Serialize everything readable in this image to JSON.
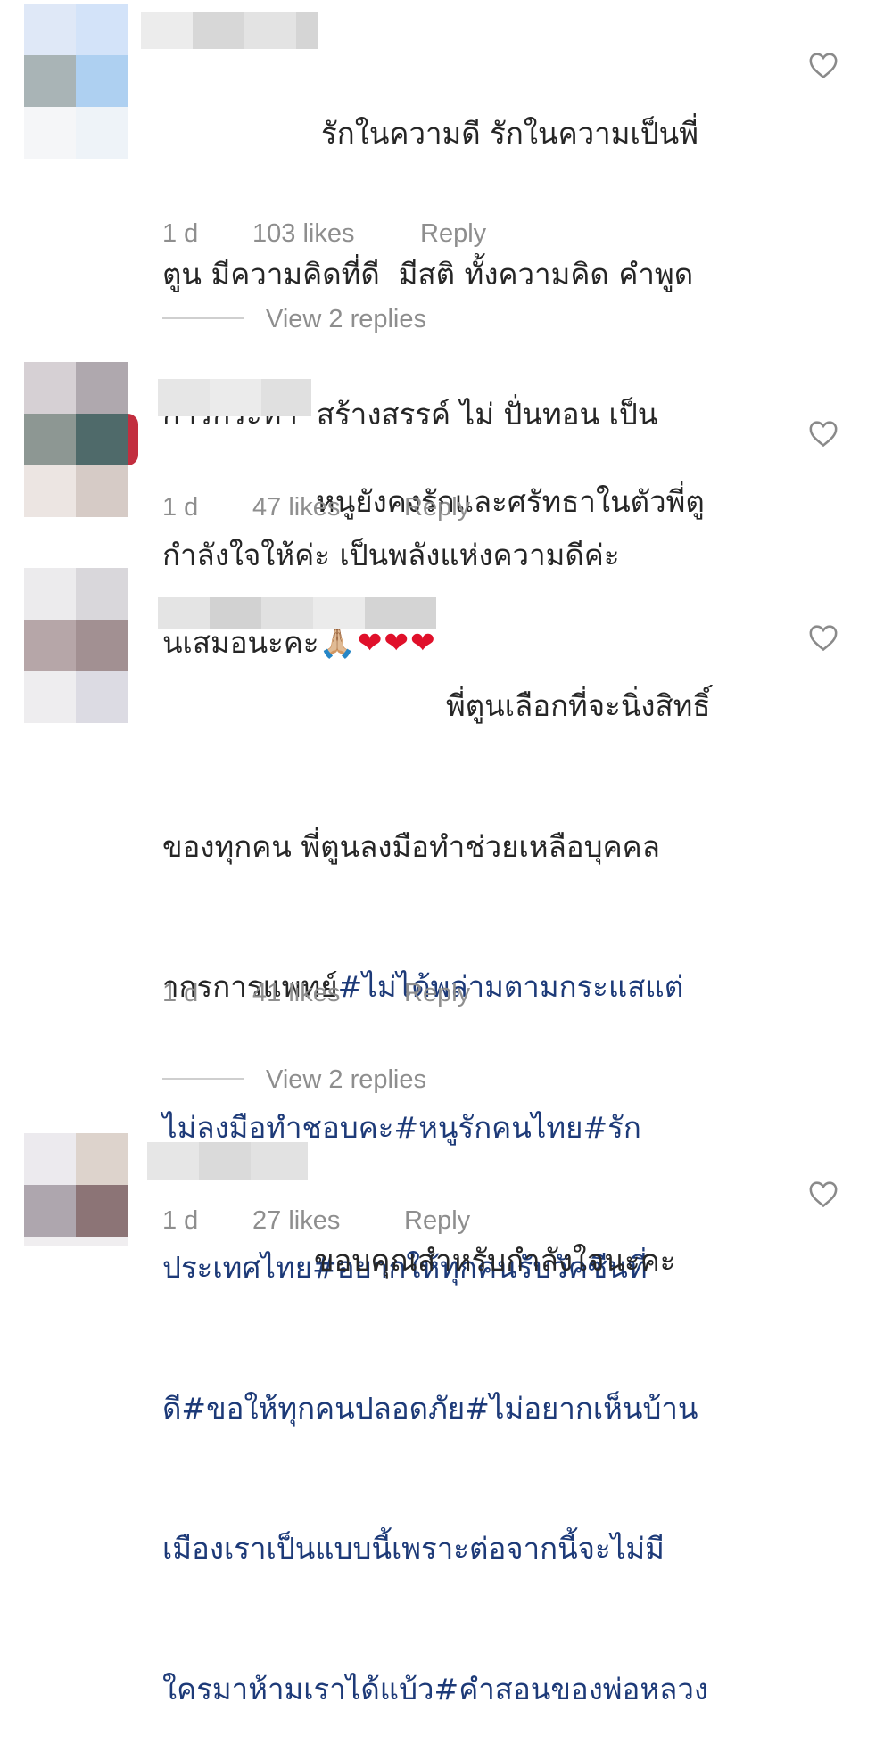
{
  "comments": [
    {
      "text": "รักในความดี รักในความเป็นพี่ตูน มีความคิดที่ดี  มีสติ ทั้งความคิด คำพูด การกระทำ  สร้างสรรค์ ไม่ ปั่นทอน เป็นกำลังใจให้ค่ะ เป็นพลังแห่งความดีค่ะ",
      "lines": [
        "รักในความดี รักในความเป็นพี่",
        "ตูน มีความคิดที่ดี  มีสติ ทั้งความคิด คำพูด",
        "การกระทำ  สร้างสรรค์ ไม่ ปั่นทอน เป็น",
        "กำลังใจให้ค่ะ เป็นพลังแห่งความดีค่ะ"
      ],
      "time": "1 d",
      "likes": "103 likes",
      "reply": "Reply",
      "view_replies": "View 2 replies"
    },
    {
      "lines": [
        "หนูยังคงรักและศรัทธาในตัวพี่ตู",
        "นเสมอนะคะ"
      ],
      "emoji": "🙏🏼❤❤❤",
      "time": "1 d",
      "likes": "47 likes",
      "reply": "Reply"
    },
    {
      "line1": "พี่ตูนเลือกที่จะนิ่งสิทธิ์",
      "line2": "ของทุกคน พี่ตูนลงมือทำช่วยเหลือบุคคล",
      "line3_plain": "ากรการแพทย์",
      "line3_tag": "#ไม่ได้พล่ามตามกระแสแต่",
      "tag_lines": [
        "ไม่ลงมือทำชอบคะ#หนูรักคนไทย#รัก",
        "ประเทศไทย#อยากให้ทุกคนรับวัคซีนที่",
        "ดี#ขอให้ทุกคนปลอดภัย#ไม่อยากเห็นบ้าน",
        "เมืองเราเป็นแบบนี้เพราะต่อจากนี้จะไม่มี",
        "ใครมาห้ามเราได้แบ้ว#คำสอนของพ่อหลวง"
      ],
      "time": "1 d",
      "likes": "41 likes",
      "reply": "Reply",
      "view_replies": "View 2 replies"
    },
    {
      "lines": [
        "ขอบคุณสำหรับกำลังใจนะคะ"
      ],
      "time": "1 d",
      "likes": "27 likes",
      "reply": "Reply"
    }
  ],
  "colors": {
    "text": "#262626",
    "meta": "#8e8e8e",
    "hashtag": "#1d3a78",
    "heart_emoji": "#e0102a"
  },
  "icons": {
    "like": "heart-outline-icon"
  }
}
